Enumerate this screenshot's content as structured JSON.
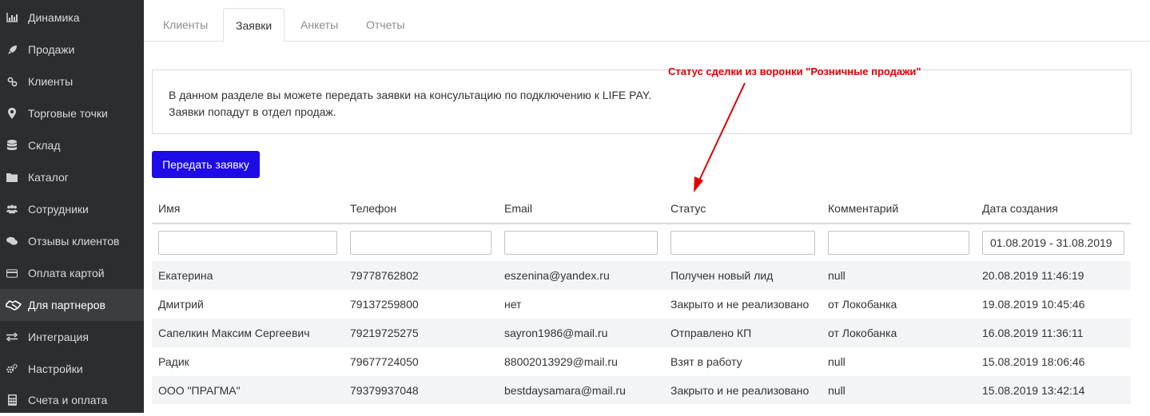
{
  "sidebar": {
    "items": [
      {
        "label": "Динамика",
        "icon": "bar-chart-icon"
      },
      {
        "label": "Продажи",
        "icon": "rocket-icon"
      },
      {
        "label": "Клиенты",
        "icon": "users-link-icon"
      },
      {
        "label": "Торговые точки",
        "icon": "map-pin-icon"
      },
      {
        "label": "Склад",
        "icon": "database-icon"
      },
      {
        "label": "Каталог",
        "icon": "folder-icon"
      },
      {
        "label": "Сотрудники",
        "icon": "people-icon"
      },
      {
        "label": "Отзывы клиентов",
        "icon": "comments-icon"
      },
      {
        "label": "Оплата картой",
        "icon": "credit-card-icon"
      },
      {
        "label": "Для партнеров",
        "icon": "handshake-icon",
        "active": true
      },
      {
        "label": "Интеграция",
        "icon": "exchange-icon"
      },
      {
        "label": "Настройки",
        "icon": "gears-icon"
      },
      {
        "label": "Счета и оплата",
        "icon": "calculator-icon"
      }
    ]
  },
  "tabs": [
    {
      "label": "Клиенты"
    },
    {
      "label": "Заявки",
      "active": true
    },
    {
      "label": "Анкеты"
    },
    {
      "label": "Отчеты"
    }
  ],
  "info": {
    "line1": "В данном разделе вы можете передать заявки на консультацию по подключению к LIFE PAY.",
    "line2": "Заявки попадут в отдел продаж."
  },
  "annotation": {
    "text": "Статус сделки из воронки \"Розничные продажи\"",
    "color": "#e00000"
  },
  "submit_button": {
    "label": "Передать заявку",
    "color": "#1d0be8"
  },
  "table": {
    "columns": [
      "Имя",
      "Телефон",
      "Email",
      "Статус",
      "Комментарий",
      "Дата создания"
    ],
    "filters": {
      "date_range": "01.08.2019 - 31.08.2019"
    },
    "rows": [
      [
        "Екатерина",
        "79778762802",
        "eszenina@yandex.ru",
        "Получен новый лид",
        "null",
        "20.08.2019 11:46:19"
      ],
      [
        "Дмитрий",
        "79137259800",
        "нет",
        "Закрыто и не реализовано",
        "от Локобанка",
        "19.08.2019 10:45:46"
      ],
      [
        "Сапелкин Максим Сергеевич",
        "79219725275",
        "sayron1986@mail.ru",
        "Отправлено КП",
        "от Локобанка",
        "16.08.2019 11:36:11"
      ],
      [
        "Радик",
        "79677724050",
        "88002013929@mail.ru",
        "Взят в работу",
        "null",
        "15.08.2019 18:06:46"
      ],
      [
        "ООО \"ПРАГМА\"",
        "79379937048",
        "bestdaysamara@mail.ru",
        "Закрыто и не реализовано",
        "null",
        "15.08.2019 13:42:14"
      ]
    ]
  }
}
